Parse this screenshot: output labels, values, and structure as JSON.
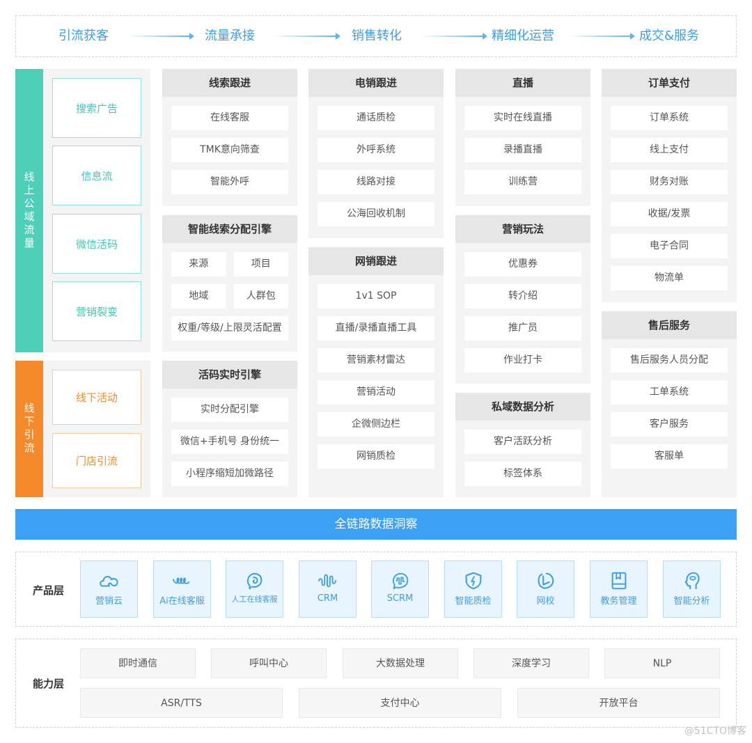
{
  "flow": {
    "steps": [
      "引流获客",
      "流量承接",
      "销售转化",
      "精细化运营",
      "成交&服务"
    ],
    "accent_color": "#3d9ee8"
  },
  "traffic": {
    "online": {
      "label": "线上公域流量",
      "color": "#4ecfb7",
      "sources": [
        "搜索广告",
        "信息流",
        "微信活码",
        "营销裂变"
      ]
    },
    "offline": {
      "label": "线下引流",
      "color": "#f58a2b",
      "sources": [
        "线下活动",
        "门店引流"
      ]
    }
  },
  "columns": {
    "col1": [
      {
        "title": "线索跟进",
        "items": [
          "在线客服",
          "TMK意向筛查",
          "智能外呼"
        ]
      },
      {
        "title": "智能线索分配引擎",
        "pairs": [
          [
            "来源",
            "项目"
          ],
          [
            "地域",
            "人群包"
          ]
        ],
        "items": [
          "权重/等级/上限灵活配置"
        ]
      },
      {
        "title": "活码实时引擎",
        "items": [
          "实时分配引擎",
          "微信+手机号 身份统一",
          "小程序缩短加微路径"
        ]
      }
    ],
    "col2": [
      {
        "title": "电销跟进",
        "items": [
          "通话质检",
          "外呼系统",
          "线路对接",
          "公海回收机制"
        ]
      },
      {
        "title": "网销跟进",
        "items": [
          "1v1 SOP",
          "直播/录播直播工具",
          "营销素材雷达",
          "营销活动",
          "企微侧边栏",
          "网销质检"
        ]
      }
    ],
    "col3": [
      {
        "title": "直播",
        "items": [
          "实时在线直播",
          "录播直播",
          "训练营"
        ]
      },
      {
        "title": "营销玩法",
        "items": [
          "优惠券",
          "转介绍",
          "推广员",
          "作业打卡"
        ]
      },
      {
        "title": "私域数据分析",
        "items": [
          "客户活跃分析",
          "标签体系"
        ]
      }
    ],
    "col4": [
      {
        "title": "订单支付",
        "items": [
          "订单系统",
          "线上支付",
          "财务对账",
          "收据/发票",
          "电子合同",
          "物流单"
        ]
      },
      {
        "title": "售后服务",
        "items": [
          "售后服务人员分配",
          "工单系统",
          "客户服务",
          "客服单"
        ]
      }
    ]
  },
  "insight": {
    "label": "全链路数据洞察",
    "color": "#3aa1f4"
  },
  "product_layer": {
    "label": "产品层",
    "products": [
      {
        "name": "营销云",
        "icon": "cloud-icon"
      },
      {
        "name": "Ai在线客服",
        "icon": "wave-loops-icon"
      },
      {
        "name": "人工在线客服",
        "icon": "chat-bubble-icon"
      },
      {
        "name": "CRM",
        "icon": "signal-wave-icon"
      },
      {
        "name": "SCRM",
        "icon": "chat-wave-icon"
      },
      {
        "name": "智能质检",
        "icon": "shield-bolt-icon"
      },
      {
        "name": "网校",
        "icon": "play-circle-icon"
      },
      {
        "name": "教务管理",
        "icon": "book-icon"
      },
      {
        "name": "智能分析",
        "icon": "head-brain-icon"
      }
    ]
  },
  "ability_layer": {
    "label": "能力层",
    "row1": [
      "即时通信",
      "呼叫中心",
      "大数据处理",
      "深度学习",
      "NLP"
    ],
    "row2": [
      "ASR/TTS",
      "支付中心",
      "开放平台"
    ]
  },
  "watermark": "@51CTO博客"
}
